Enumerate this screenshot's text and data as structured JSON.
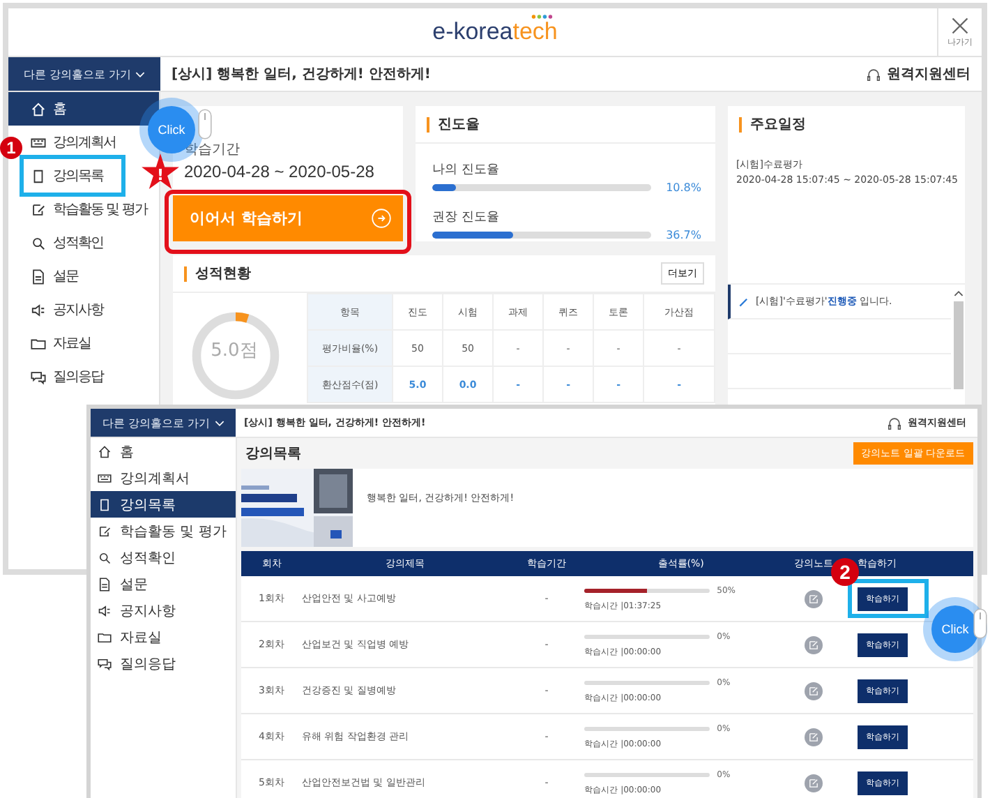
{
  "back_window": {
    "logo": {
      "prefix": "e-korea",
      "suffix": "tech"
    },
    "exit_label": "나가기",
    "course_select": "다른 강의홀으로 가기",
    "notice": "[상시] 행복한 일터, 건강하게! 안전하게!",
    "support": "원격지원센터",
    "menu": [
      {
        "label": "홈",
        "selected": true
      },
      {
        "label": "강의계획서",
        "selected": false
      },
      {
        "label": "강의목록",
        "selected": false
      },
      {
        "label": "학습활동 및 평가",
        "selected": false
      },
      {
        "label": "성적확인",
        "selected": false
      },
      {
        "label": "설문",
        "selected": false
      },
      {
        "label": "공지사항",
        "selected": false
      },
      {
        "label": "자료실",
        "selected": false
      },
      {
        "label": "질의응답",
        "selected": false
      }
    ],
    "period_label": "학습기간",
    "period": "2020-04-28 ~ 2020-05-28",
    "continue_button": "이어서 학습하기",
    "progress": {
      "title": "진도율",
      "items": [
        {
          "label": "나의 진도율",
          "level": 0.108,
          "reading": "10.8%"
        },
        {
          "label": "권장 진도율",
          "level": 0.367,
          "reading": "36.7%"
        }
      ]
    },
    "schedule": {
      "title": "주요일정",
      "event": "[시험]수료평가",
      "time": "2020-04-28 15:07:45 ~ 2020-05-28 15:07:45",
      "status_prefix": "[시험]'수료평가'",
      "status_highlight": "진행중",
      "status_suffix": "입니다."
    },
    "grades": {
      "title": "성적현황",
      "more_button": "더보기",
      "score": "5.0점",
      "level": 0.05,
      "columns": [
        "항목",
        "진도",
        "시험",
        "과제",
        "퀴즈",
        "토론",
        "가산점"
      ],
      "rows": [
        {
          "cells": [
            "평가비율(%)",
            "50",
            "50",
            "-",
            "-",
            "-",
            "-"
          ],
          "highlight": false
        },
        {
          "cells": [
            "환산점수(점)",
            "5.0",
            "0.0",
            "-",
            "-",
            "-",
            "-"
          ],
          "highlight": true
        }
      ]
    }
  },
  "front_window": {
    "course_select": "다른 강의홀으로 가기",
    "notice": "[상시] 행복한 일터, 건강하게! 안전하게!",
    "support": "원격지원센터",
    "menu": [
      {
        "label": "홈",
        "selected": false
      },
      {
        "label": "강의계획서",
        "selected": false
      },
      {
        "label": "강의목록",
        "selected": true
      },
      {
        "label": "학습활동 및 평가",
        "selected": false
      },
      {
        "label": "성적확인",
        "selected": false
      },
      {
        "label": "설문",
        "selected": false
      },
      {
        "label": "공지사항",
        "selected": false
      },
      {
        "label": "자료실",
        "selected": false
      },
      {
        "label": "질의응답",
        "selected": false
      }
    ],
    "page_title": "강의목록",
    "download_button": "강의노트 일괄 다운로드",
    "banner": {
      "kind": "picture",
      "caption": "행복한 일터, 건강하게! 안전하게!"
    },
    "table": {
      "columns": [
        "회차",
        "강의제목",
        "학습기간",
        "출석률(%)",
        "강의노트",
        "학습하기"
      ],
      "rows": [
        {
          "round": "1회차",
          "title": "산업안전 및 사고예방",
          "period": "-",
          "level": 0.5,
          "reading": "50%",
          "study_time": "학습시간 |01:37:25",
          "button": "학습하기"
        },
        {
          "round": "2회차",
          "title": "산업보건 및 직업병 예방",
          "period": "-",
          "level": 0,
          "reading": "0%",
          "study_time": "학습시간 |00:00:00",
          "button": "학습하기"
        },
        {
          "round": "3회차",
          "title": "건강증진 및 질병예방",
          "period": "-",
          "level": 0,
          "reading": "0%",
          "study_time": "학습시간 |00:00:00",
          "button": "학습하기"
        },
        {
          "round": "4회차",
          "title": "유해 위험 작업환경 관리",
          "period": "-",
          "level": 0,
          "reading": "0%",
          "study_time": "학습시간 |00:00:00",
          "button": "학습하기"
        },
        {
          "round": "5회차",
          "title": "산업안전보건법 및 일반관리",
          "period": "-",
          "level": 0,
          "reading": "0%",
          "study_time": "학습시간 |00:00:00",
          "button": "학습하기"
        }
      ]
    }
  },
  "annotations": {
    "steps": [
      {
        "number": "1",
        "click": "Click"
      },
      {
        "number": "2",
        "click": "Click"
      }
    ],
    "warning": "!"
  }
}
